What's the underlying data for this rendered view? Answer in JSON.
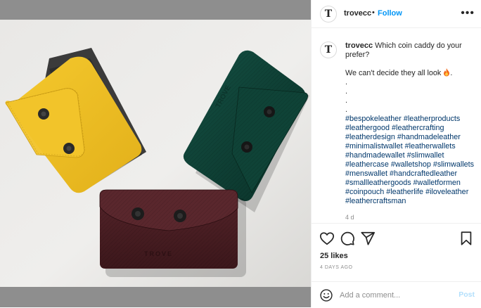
{
  "post": {
    "account": {
      "username": "trovecc",
      "follow_label": "Follow",
      "separator": "•",
      "avatar_letter": "T"
    },
    "caption": {
      "username": "trovecc",
      "text": "Which coin caddy do your prefer?",
      "line2": "We can't decide they all look",
      "dots": [
        ".",
        ".",
        ".",
        "."
      ],
      "hashtags": [
        "#bespokeleather",
        "#leatherproducts",
        "#leathergood",
        "#leathercrafting",
        "#leatherdesign",
        "#handmadeleather",
        "#minimalistwallet",
        "#leatherwallets",
        "#handmadewallet",
        "#slimwallet",
        "#leathercase",
        "#walletshop",
        "#slimwallets",
        "#menswallet",
        "#handcraftedleather",
        "#smallleathergoods",
        "#walletformen",
        "#coinpouch",
        "#leatherlife",
        "#iloveleather",
        "#leathercraftsman"
      ],
      "time_ago": "4 d"
    },
    "likes": "25 likes",
    "date": "4 DAYS AGO",
    "comment": {
      "placeholder": "Add a comment...",
      "post_label": "Post"
    },
    "photo": {
      "embossed_brand": "TROVE",
      "colors": {
        "yellow": "#f2c22a",
        "green": "#0f3f34",
        "burgundy": "#4a1e22"
      }
    }
  }
}
